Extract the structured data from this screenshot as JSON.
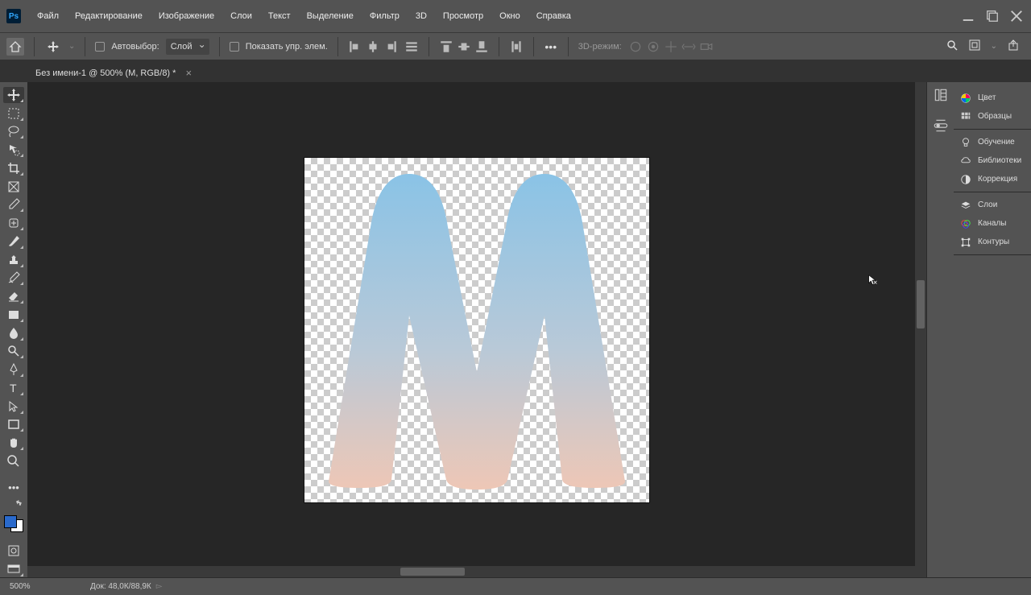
{
  "app": {
    "logo": "Ps"
  },
  "menu": [
    "Файл",
    "Редактирование",
    "Изображение",
    "Слои",
    "Текст",
    "Выделение",
    "Фильтр",
    "3D",
    "Просмотр",
    "Окно",
    "Справка"
  ],
  "options": {
    "autoselect_label": "Автовыбор:",
    "autoselect_target": "Слой",
    "show_controls": "Показать упр. элем.",
    "mode3d": "3D-режим:"
  },
  "doc_tab": {
    "title": "Без имени-1 @ 500% (M, RGB/8) *"
  },
  "panels": {
    "g1": [
      {
        "icon": "color-wheel",
        "label": "Цвет"
      },
      {
        "icon": "swatches",
        "label": "Образцы"
      }
    ],
    "g2": [
      {
        "icon": "bulb",
        "label": "Обучение"
      },
      {
        "icon": "cloud",
        "label": "Библиотеки"
      },
      {
        "icon": "adjust",
        "label": "Коррекция"
      }
    ],
    "g3": [
      {
        "icon": "layers",
        "label": "Слои"
      },
      {
        "icon": "channels",
        "label": "Каналы"
      },
      {
        "icon": "paths",
        "label": "Контуры"
      }
    ]
  },
  "status": {
    "zoom": "500%",
    "doc": "Док: 48,0К/88,9К"
  },
  "canvas": {
    "letter": "M",
    "grad_top": "#8ac3e6",
    "grad_bottom": "#eec7b6"
  }
}
